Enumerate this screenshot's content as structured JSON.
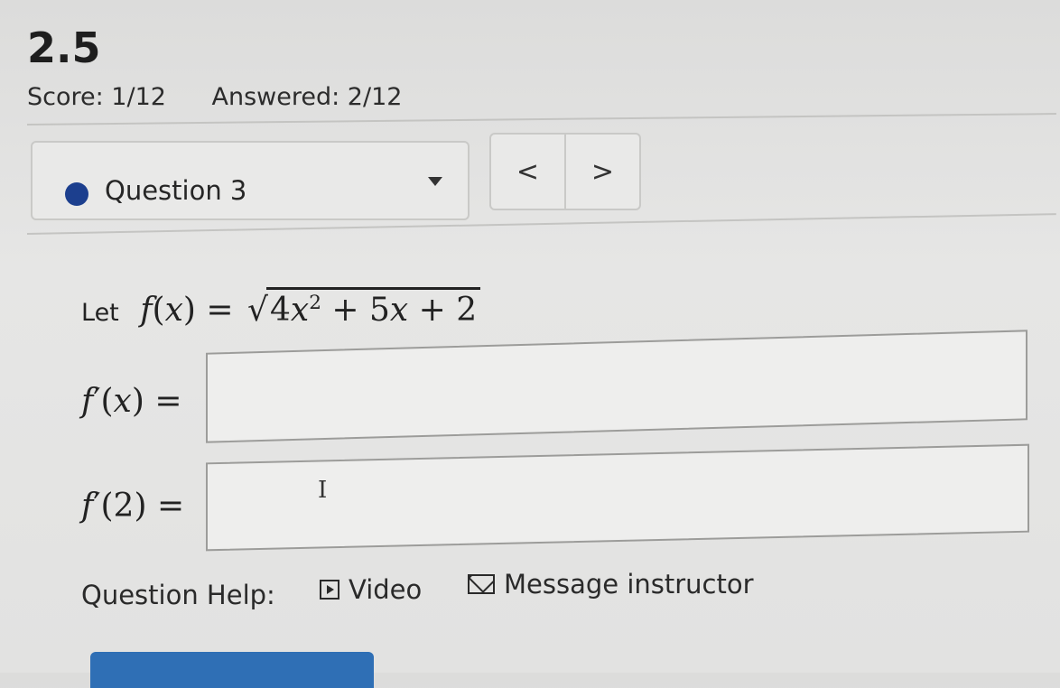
{
  "header": {
    "title": "2.5",
    "score": "Score: 1/12",
    "answered": "Answered: 2/12"
  },
  "question_nav": {
    "selected_question": "Question 3",
    "prev_symbol": "<",
    "next_symbol": ">"
  },
  "problem": {
    "let_word": "Let",
    "function_name": "f",
    "variable": "x",
    "radicand_lead": "4",
    "radicand_exponent": "2",
    "radicand_tail": "+ 5",
    "radicand_const": "+ 2"
  },
  "answers": [
    {
      "label_func": "f",
      "label_arg": "x",
      "value": ""
    },
    {
      "label_func": "f",
      "label_arg": "2",
      "value": ""
    }
  ],
  "help": {
    "label": "Question Help:",
    "video": "Video",
    "message": "Message instructor"
  },
  "colors": {
    "accent": "#1c3f8e",
    "submit": "#2f6fb5"
  }
}
